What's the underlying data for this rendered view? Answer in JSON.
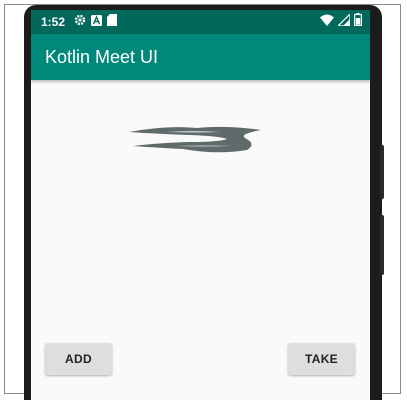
{
  "status_bar": {
    "time": "1:52",
    "left_icons": [
      "gear-icon",
      "a-badge-icon",
      "sd-card-icon"
    ],
    "right_icons": [
      "wifi-icon",
      "signal-icon",
      "battery-icon"
    ]
  },
  "app_bar": {
    "title": "Kotlin Meet UI"
  },
  "buttons": {
    "add_label": "ADD",
    "take_label": "TAKE"
  },
  "colors": {
    "status_bar": "#00695c",
    "app_bar": "#00897b",
    "background": "#fafafa",
    "button": "#dedede",
    "graphic": "#5f6b6a"
  }
}
